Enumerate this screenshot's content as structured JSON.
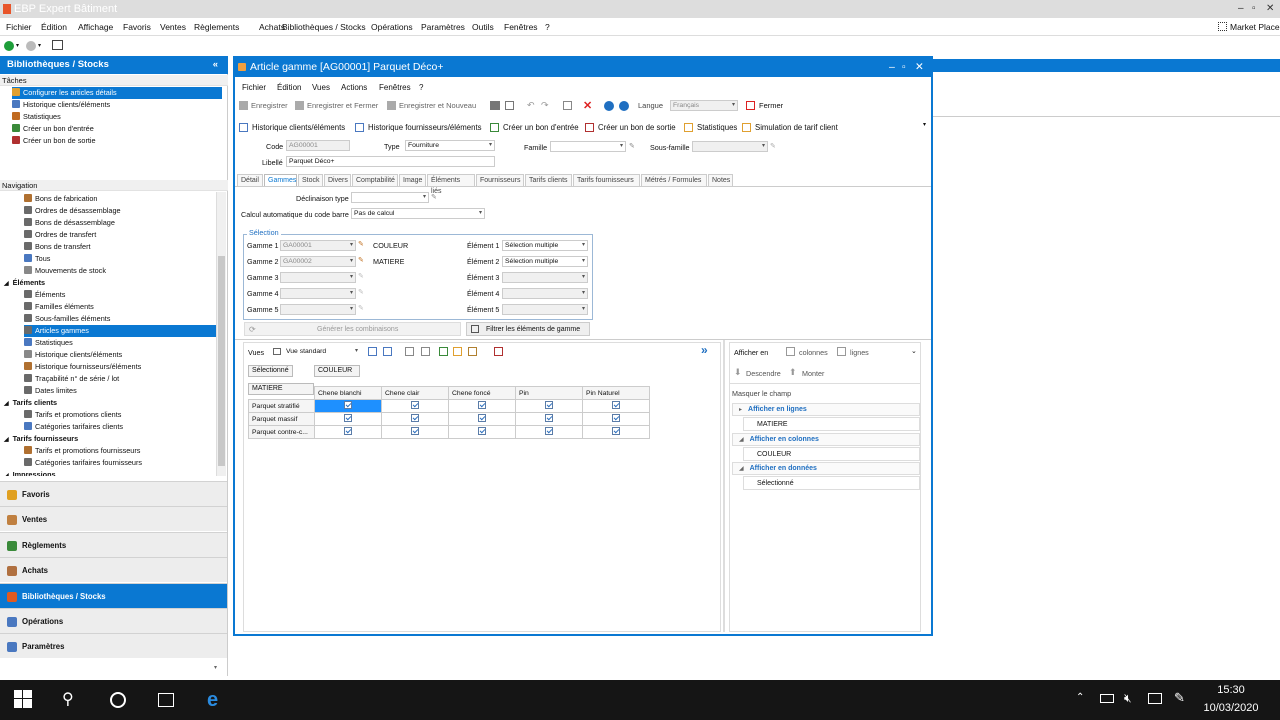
{
  "app_title": "EBP Expert Bâtiment",
  "market": "Market Place",
  "main_menu": [
    "Fichier",
    "Édition",
    "Affichage",
    "Favoris",
    "Ventes",
    "Règlements",
    "Achats",
    "Bibliothèques / Stocks",
    "Opérations",
    "Paramètres",
    "Outils",
    "Fenêtres",
    "?"
  ],
  "left": {
    "header": "Bibliothèques / Stocks",
    "tasks_title": "Tâches",
    "tasks": [
      "Configurer les articles détails",
      "Historique clients/éléments",
      "Statistiques",
      "Créer un bon d'entrée",
      "Créer un bon de sortie"
    ],
    "nav_title": "Navigation",
    "nav": [
      {
        "label": "Bons de fabrication",
        "lvl": 2
      },
      {
        "label": "Ordres de désassemblage",
        "lvl": 2
      },
      {
        "label": "Bons de désassemblage",
        "lvl": 2
      },
      {
        "label": "Ordres de transfert",
        "lvl": 2
      },
      {
        "label": "Bons de transfert",
        "lvl": 2
      },
      {
        "label": "Tous",
        "lvl": 2
      },
      {
        "label": "Mouvements de stock",
        "lvl": 2
      },
      {
        "label": "Éléments",
        "lvl": 1
      },
      {
        "label": "Éléments",
        "lvl": 2
      },
      {
        "label": "Familles éléments",
        "lvl": 2
      },
      {
        "label": "Sous-familles éléments",
        "lvl": 2
      },
      {
        "label": "Articles gammes",
        "lvl": 2
      },
      {
        "label": "Statistiques",
        "lvl": 2
      },
      {
        "label": "Historique clients/éléments",
        "lvl": 2
      },
      {
        "label": "Historique fournisseurs/éléments",
        "lvl": 2
      },
      {
        "label": "Traçabilité n° de série / lot",
        "lvl": 2
      },
      {
        "label": "Dates limites",
        "lvl": 2
      },
      {
        "label": "Tarifs clients",
        "lvl": 1
      },
      {
        "label": "Tarifs et promotions clients",
        "lvl": 2
      },
      {
        "label": "Catégories tarifaires clients",
        "lvl": 2
      },
      {
        "label": "Tarifs fournisseurs",
        "lvl": 1
      },
      {
        "label": "Tarifs et promotions fournisseurs",
        "lvl": 2
      },
      {
        "label": "Catégories tarifaires fournisseurs",
        "lvl": 2
      },
      {
        "label": "Impressions",
        "lvl": 1
      }
    ],
    "big": [
      "Favoris",
      "Ventes",
      "Règlements",
      "Achats",
      "Bibliothèques / Stocks",
      "Opérations",
      "Paramètres"
    ]
  },
  "win": {
    "title": "Article gamme [AG00001] Parquet Déco+",
    "menu": [
      "Fichier",
      "Édition",
      "Vues",
      "Actions",
      "Fenêtres",
      "?"
    ],
    "tb1": {
      "save": "Enregistrer",
      "save_close": "Enregistrer et Fermer",
      "save_new": "Enregistrer et Nouveau",
      "lang_lbl": "Langue",
      "lang": "Français",
      "close": "Fermer"
    },
    "tb2": [
      "Historique clients/éléments",
      "Historique fournisseurs/éléments",
      "Créer un bon d'entrée",
      "Créer un bon de sortie",
      "Statistiques",
      "Simulation de tarif client"
    ],
    "code_lbl": "Code",
    "code": "AG00001",
    "type_lbl": "Type",
    "type": "Fourniture",
    "famille_lbl": "Famille",
    "sousfam_lbl": "Sous-famille",
    "libelle_lbl": "Libellé",
    "libelle": "Parquet Déco+",
    "tabs": [
      "Détail",
      "Gammes",
      "Stock",
      "Divers",
      "Comptabilité",
      "Image",
      "Éléments liés",
      "Fournisseurs",
      "Tarifs clients",
      "Tarifs fournisseurs",
      "Métrés / Formules",
      "Notes"
    ],
    "decl_lbl": "Déclinaison type",
    "calc_lbl": "Calcul automatique du code barre",
    "calc": "Pas de calcul",
    "selection": "Sélection",
    "gammes": [
      {
        "lbl": "Gamme 1",
        "code": "GA00001",
        "name": "COULEUR",
        "el_lbl": "Élément 1",
        "el": "Sélection multiple"
      },
      {
        "lbl": "Gamme 2",
        "code": "GA00002",
        "name": "MATIERE",
        "el_lbl": "Élément 2",
        "el": "Sélection multiple"
      },
      {
        "lbl": "Gamme 3",
        "code": "",
        "name": "",
        "el_lbl": "Élément 3",
        "el": ""
      },
      {
        "lbl": "Gamme 4",
        "code": "",
        "name": "",
        "el_lbl": "Élément 4",
        "el": ""
      },
      {
        "lbl": "Gamme 5",
        "code": "",
        "name": "",
        "el_lbl": "Élément 5",
        "el": ""
      }
    ],
    "gen_btn": "Générer les combinaisons",
    "filter_btn": "Filtrer les éléments de gamme",
    "vues_lbl": "Vues",
    "vue": "Vue standard",
    "pivot_sel": "Sélectionné",
    "pivot_col": "COULEUR",
    "pivot_row": "MATIERE",
    "cols": [
      "Chene blanchi",
      "Chene clair",
      "Chene foncé",
      "Pin",
      "Pin Naturel"
    ],
    "rows": [
      "Parquet stratifié",
      "Parquet massif",
      "Parquet contre-c..."
    ],
    "right": {
      "afficher": "Afficher en",
      "colonnes": "colonnes",
      "lignes": "lignes",
      "descendre": "Descendre",
      "monter": "Monter",
      "masquer": "Masquer le champ",
      "groups": [
        {
          "t": "Afficher en lignes",
          "v": "MATIERE"
        },
        {
          "t": "Afficher en colonnes",
          "v": "COULEUR"
        },
        {
          "t": "Afficher en données",
          "v": "Sélectionné"
        }
      ]
    }
  },
  "clock": {
    "time": "15:30",
    "date": "10/03/2020"
  }
}
